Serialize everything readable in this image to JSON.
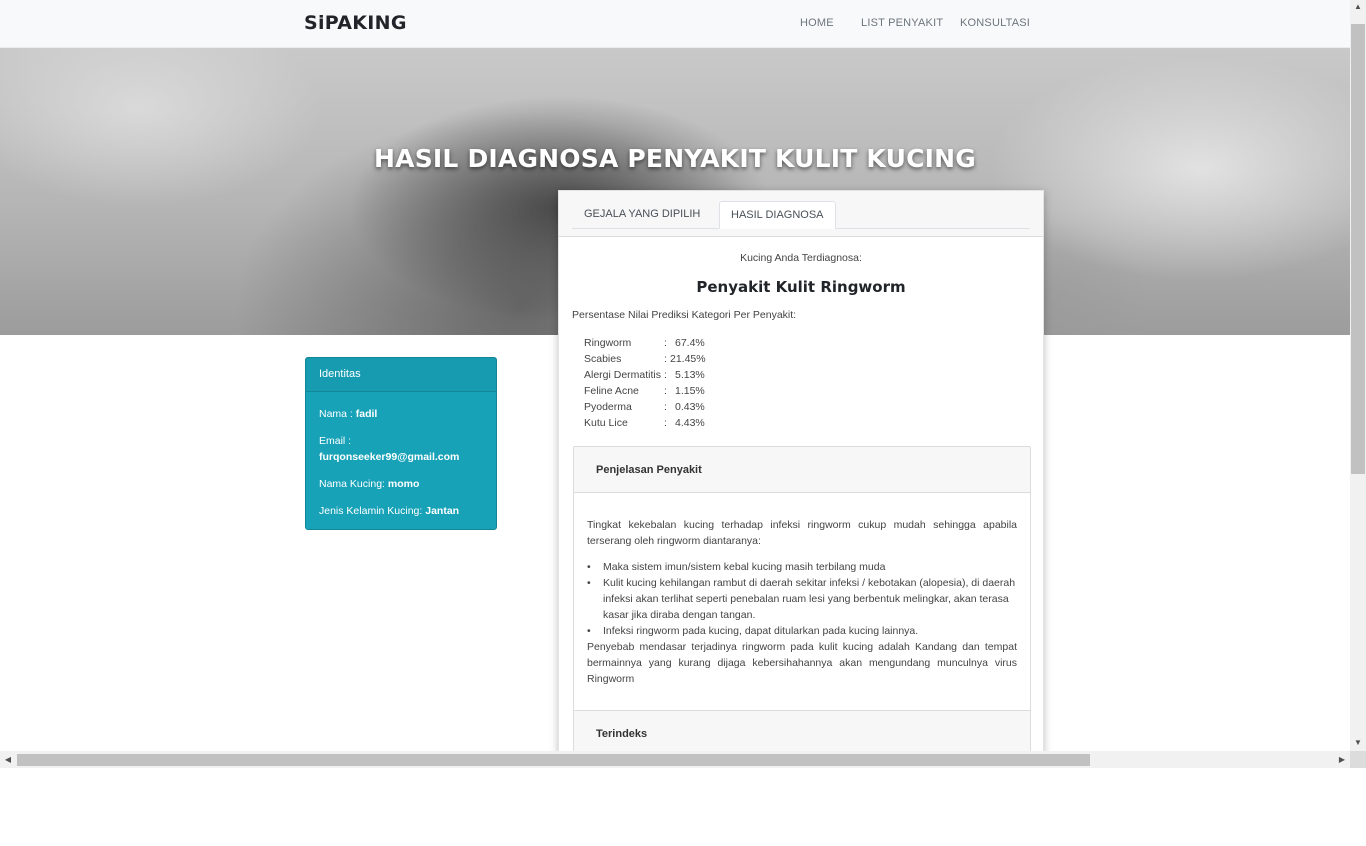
{
  "navbar": {
    "brand": "SiPAKING",
    "links": [
      "HOME",
      "LIST PENYAKIT",
      "KONSULTASI"
    ]
  },
  "hero": {
    "title": "HASIL DIAGNOSA PENYAKIT KULIT KUCING"
  },
  "identity": {
    "header": "Identitas",
    "nama_label": "Nama : ",
    "nama_value": "fadil",
    "email_label": "Email : ",
    "email_value": "furqonseeker99@gmail.com",
    "kucing_label": "Nama Kucing: ",
    "kucing_value": "momo",
    "kelamin_label": "Jenis Kelamin Kucing: ",
    "kelamin_value": "Jantan"
  },
  "tabs": [
    "GEJALA YANG DIPILIH",
    "HASIL DIAGNOSA"
  ],
  "active_tab": "HASIL DIAGNOSA",
  "diagnosis": {
    "label": "Kucing Anda Terdiagnosa:",
    "result": "Penyakit Kulit Ringworm",
    "percent_title": "Persentase Nilai Prediksi Kategori Per Penyakit:",
    "percentages": [
      {
        "name": "Ringworm",
        "value": "67.4%"
      },
      {
        "name": "Scabies",
        "value": "21.45%"
      },
      {
        "name": "Alergi Dermatitis",
        "value": "5.13%"
      },
      {
        "name": "Feline Acne",
        "value": "1.15%"
      },
      {
        "name": "Pyoderma",
        "value": "0.43%"
      },
      {
        "name": "Kutu Lice",
        "value": "4.43%"
      }
    ]
  },
  "explanation": {
    "header": "Penjelasan Penyakit",
    "intro": "Tingkat kekebalan kucing terhadap infeksi ringworm cukup mudah sehingga apabila terserang oleh ringworm diantaranya:",
    "bullets": [
      "Maka sistem imun/sistem kebal kucing masih terbilang muda",
      "Kulit kucing kehilangan rambut di daerah sekitar infeksi / kebotakan (alopesia), di daerah infeksi akan terlihat seperti penebalan ruam lesi yang berbentuk melingkar, akan terasa kasar jika diraba dengan tangan.",
      "Infeksi ringworm pada kucing, dapat ditularkan pada kucing lainnya."
    ],
    "cause": "Penyebab mendasar terjadinya ringworm pada kulit kucing adalah Kandang dan tempat bermainnya yang kurang dijaga kebersihahannya akan mengundang munculnya virus Ringworm"
  },
  "terindeks": {
    "header": "Terindeks"
  },
  "colors": {
    "identity_bg": "#17a2b8",
    "navbar_bg": "#f8f9fa"
  },
  "icons": {
    "scroll_up": "triangle-up-icon",
    "scroll_down": "triangle-down-icon",
    "scroll_left": "triangle-left-icon",
    "scroll_right": "triangle-right-icon"
  }
}
